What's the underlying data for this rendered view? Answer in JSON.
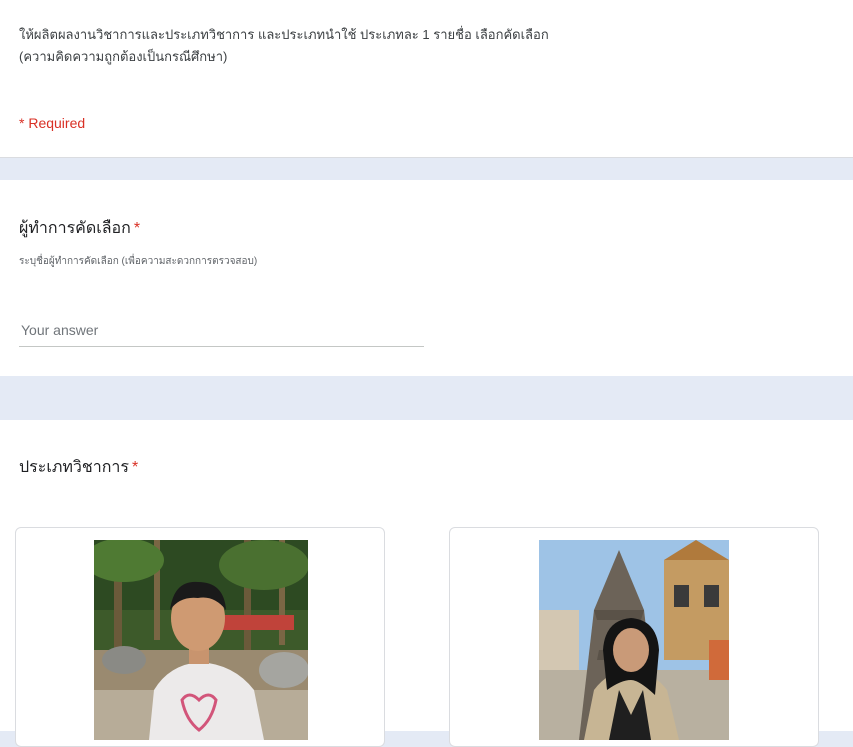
{
  "intro": {
    "line1": "ให้ผลิตผลงานวิชาการและประเภทวิชาการ และประเภทนำใช้ ประเภทละ 1 รายชื่อ เลือกคัดเลือก",
    "line2": "(ความคิดความถูกต้องเป็นกรณีศึกษา)",
    "required_note": "* Required"
  },
  "question1": {
    "title": "ผู้ทำการคัดเลือก",
    "required_mark": "*",
    "description": "ระบุชื่อผู้ทำการคัดเลือก (เพื่อความสะดวกการตรวจสอบ)",
    "placeholder": "Your answer",
    "value": ""
  },
  "question2": {
    "title": "ประเภทวิชาการ",
    "required_mark": "*",
    "options": [
      {
        "image": "photo-man-garden-icon"
      },
      {
        "image": "photo-woman-temple-icon"
      }
    ]
  },
  "colors": {
    "background": "#e4eaf5",
    "card": "#ffffff",
    "required": "#d93025",
    "text": "#202124",
    "muted": "#5f6368"
  }
}
